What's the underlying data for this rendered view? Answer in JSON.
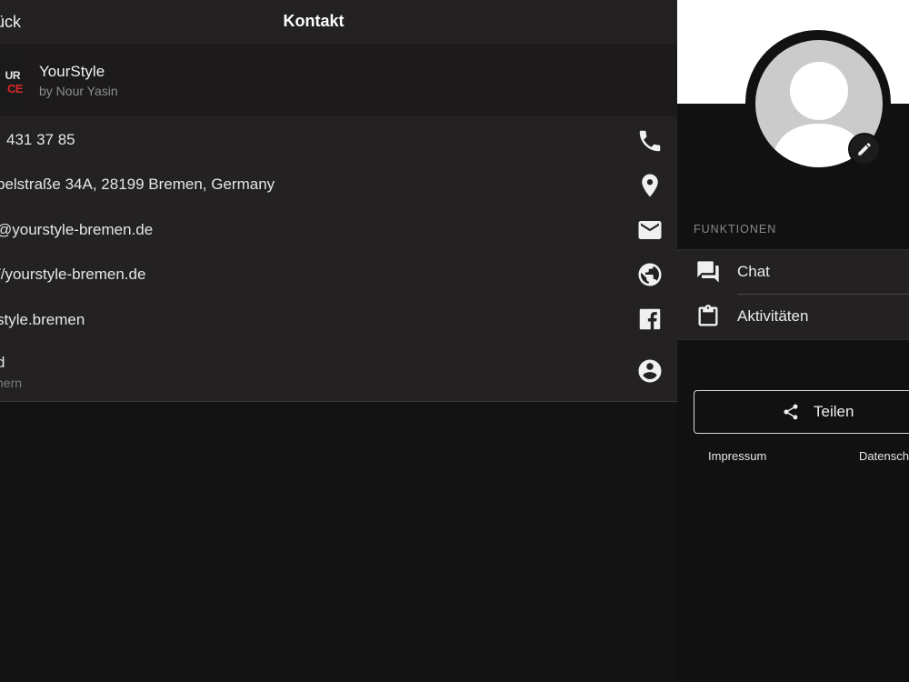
{
  "header": {
    "back_label": "ück",
    "title": "Kontakt"
  },
  "business": {
    "logo_line1": "UR",
    "logo_line2": "CE",
    "name": "YourStyle",
    "subtitle": "by Nour Yasin"
  },
  "contacts": [
    {
      "text": "431 37 85",
      "sub": "",
      "icon": "phone-icon"
    },
    {
      "text": "pelstraße 34A, 28199 Bremen, Germany",
      "sub": "",
      "icon": "location-pin-icon"
    },
    {
      "text": "@yourstyle-bremen.de",
      "sub": "",
      "icon": "mail-icon"
    },
    {
      "text": "//yourstyle-bremen.de",
      "sub": "",
      "icon": "globe-icon"
    },
    {
      "text": "style.bremen",
      "sub": "",
      "icon": "facebook-icon"
    },
    {
      "text": "d",
      "sub": "hern",
      "icon": "account-circle-icon"
    }
  ],
  "right": {
    "section_label": "FUNKTIONEN",
    "functions": [
      {
        "label": "Chat",
        "icon": "chat-icon"
      },
      {
        "label": "Aktivitäten",
        "icon": "clipboard-icon"
      }
    ],
    "share_label": "Teilen",
    "footer": {
      "impressum": "Impressum",
      "datenschutz": "Datensch"
    }
  },
  "colors": {
    "background": "#121112",
    "panel": "#232122",
    "header_white": "#ffffff",
    "avatar": "#cbcbcb"
  }
}
